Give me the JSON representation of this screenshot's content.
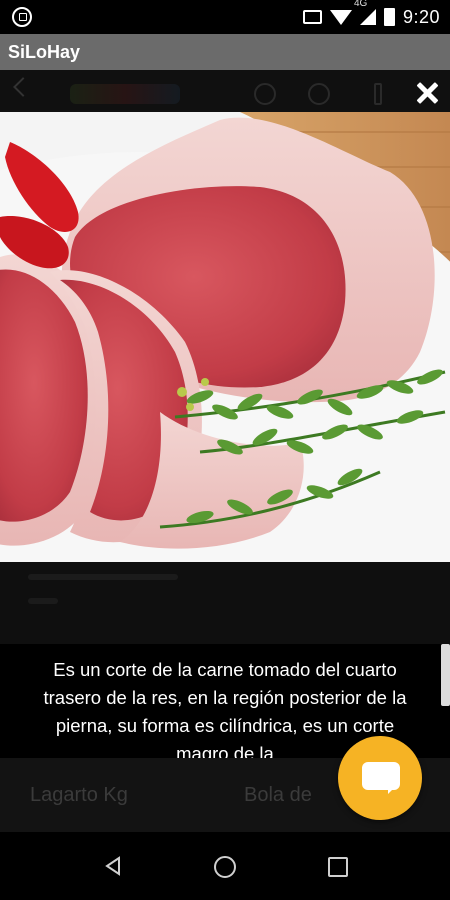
{
  "status_bar": {
    "network": "4G",
    "time": "9:20",
    "icons": [
      "app-status-icon",
      "cast-icon",
      "wifi-icon",
      "signal-icon",
      "battery-icon"
    ]
  },
  "app": {
    "title": "SiLoHay"
  },
  "dialog": {
    "close_icon": "close-icon",
    "image_subject": "meat-cut-photo",
    "description": "Es un corte de la carne tomado del cuarto trasero de la res, en la región posterior de la pierna, su forma es cilíndrica, es un corte magro de la"
  },
  "background_products": [
    {
      "name": "Lagarto Kg"
    },
    {
      "name": "Bola de"
    }
  ],
  "fab": {
    "icon": "chat-icon",
    "color": "#f6b324"
  },
  "nav_bar": {
    "icons": [
      "back-icon",
      "home-icon",
      "recents-icon"
    ]
  }
}
